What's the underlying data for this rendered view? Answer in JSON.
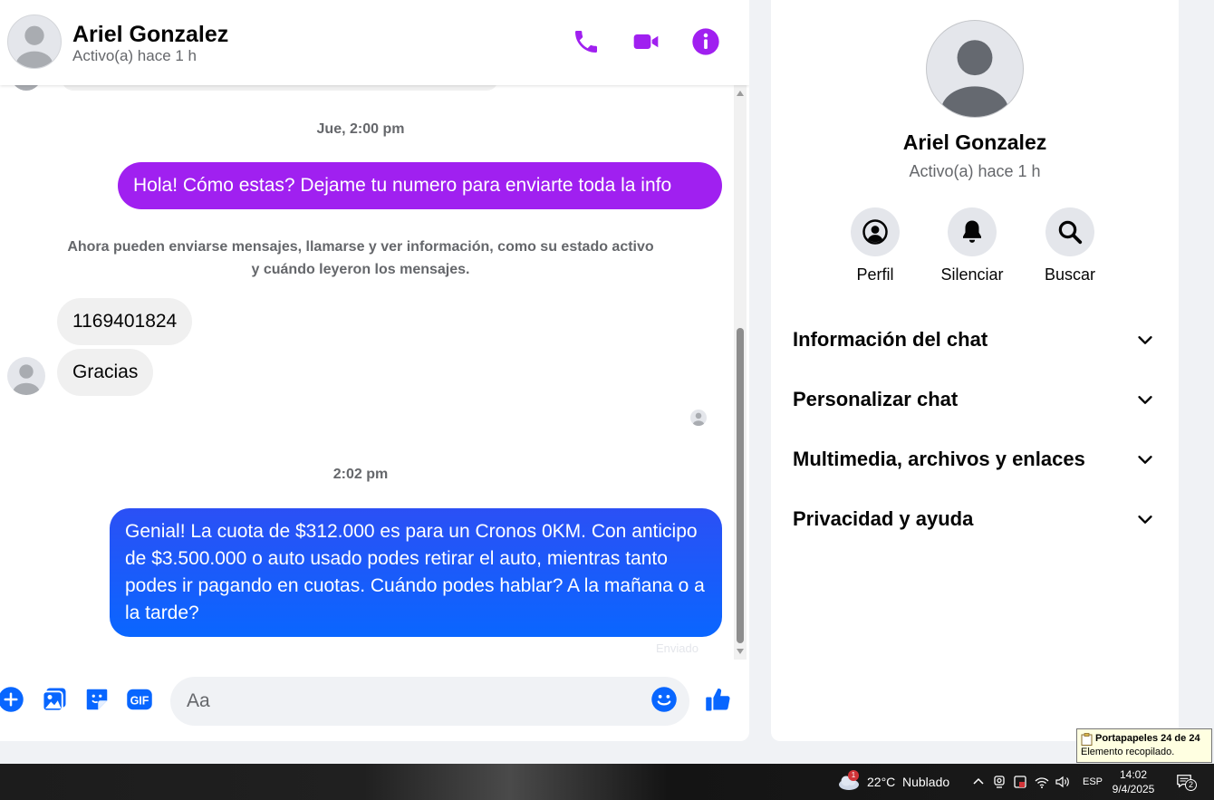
{
  "header": {
    "name": "Ariel Gonzalez",
    "status": "Activo(a) hace 1 h"
  },
  "colors": {
    "accent_purple": "#a020f0",
    "accent_blue": "#0866ff",
    "gradient_blue_start": "#2b50f5",
    "gradient_blue_end": "#0a66ff"
  },
  "messages": {
    "timestamp_1": "Jue, 2:00 pm",
    "outgoing_1": "Hola! Cómo estas? Dejame tu numero para enviarte toda la info",
    "system_note": "Ahora pueden enviarse mensajes, llamarse y ver información, como su estado activo y cuándo leyeron los mensajes.",
    "incoming_1": "1169401824",
    "incoming_2": "Gracias",
    "timestamp_2": "2:02 pm",
    "outgoing_2": "Genial! La cuota de $312.000 es para un Cronos 0KM. Con anticipo de $3.500.000 o auto usado podes retirar el auto, mientras tanto podes ir pagando en cuotas. Cuándo podes hablar? A la mañana o a la tarde?",
    "sent_label": "Enviado"
  },
  "composer": {
    "placeholder": "Aa",
    "icons": [
      "plus-circle-icon",
      "photo-icon",
      "sticker-icon",
      "gif-icon",
      "emoji-icon",
      "thumbs-up-icon"
    ]
  },
  "info_panel": {
    "name": "Ariel Gonzalez",
    "status": "Activo(a) hace 1 h",
    "actions": [
      {
        "label": "Perfil",
        "icon": "profile-icon"
      },
      {
        "label": "Silenciar",
        "icon": "bell-icon"
      },
      {
        "label": "Buscar",
        "icon": "search-icon"
      }
    ],
    "sections": [
      {
        "label": "Información del chat"
      },
      {
        "label": "Personalizar chat"
      },
      {
        "label": "Multimedia, archivos y enlaces"
      },
      {
        "label": "Privacidad y ayuda"
      }
    ]
  },
  "clipboard": {
    "title": "Portapapeles 24 de 24",
    "body": "Elemento recopilado."
  },
  "taskbar": {
    "weather_badge": "1",
    "temperature": "22°C",
    "weather": "Nublado",
    "language": "ESP",
    "time": "14:02",
    "date": "9/4/2025",
    "notification_count": "2"
  }
}
